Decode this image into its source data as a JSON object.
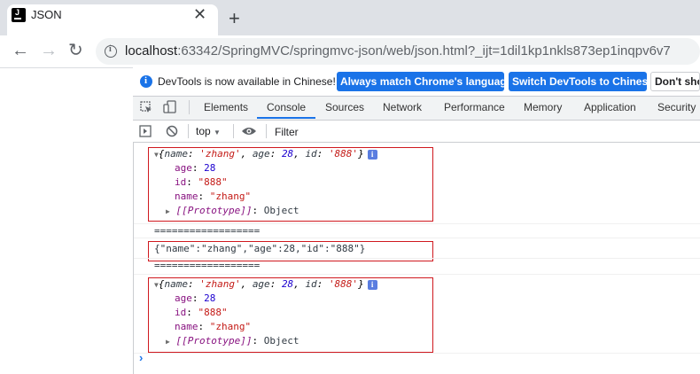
{
  "browser": {
    "tab": {
      "title": "JSON",
      "favicon": "intellij-icon"
    },
    "new_tab": "+",
    "url": {
      "host": "localhost",
      "rest": ":63342/SpringMVC/springmvc-json/web/json.html?_ijt=1dil1kp1nkls873ep1inqpv6v7"
    }
  },
  "devtools": {
    "infobar": {
      "message": "DevTools is now available in Chinese!",
      "btn_match": "Always match Chrome's language",
      "btn_switch": "Switch DevTools to Chinese",
      "btn_dont": "Don't show again"
    },
    "tabs": [
      "Elements",
      "Console",
      "Sources",
      "Network",
      "Performance",
      "Memory",
      "Application",
      "Security"
    ],
    "active_tab": "Console",
    "context": "top",
    "filter_placeholder": "Filter"
  },
  "console": {
    "obj1": {
      "preview": {
        "name": "'zhang'",
        "age": "28",
        "id": "'888'"
      },
      "props": [
        {
          "key": "age",
          "value": "28",
          "type": "number"
        },
        {
          "key": "id",
          "value": "\"888\"",
          "type": "string"
        },
        {
          "key": "name",
          "value": "\"zhang\"",
          "type": "string"
        }
      ],
      "proto_key": "[[Prototype]]",
      "proto_value": "Object"
    },
    "separator1": "==================",
    "json_string": "{\"name\":\"zhang\",\"age\":28,\"id\":\"888\"}",
    "separator2": "==================",
    "obj2": {
      "preview": {
        "name": "'zhang'",
        "age": "28",
        "id": "'888'"
      },
      "props": [
        {
          "key": "age",
          "value": "28",
          "type": "number"
        },
        {
          "key": "id",
          "value": "\"888\"",
          "type": "string"
        },
        {
          "key": "name",
          "value": "\"zhang\"",
          "type": "string"
        }
      ],
      "proto_key": "[[Prototype]]",
      "proto_value": "Object"
    },
    "prompt": "›"
  },
  "colors": {
    "highlight_box": "#d0191f",
    "accent": "#1a73e8"
  }
}
